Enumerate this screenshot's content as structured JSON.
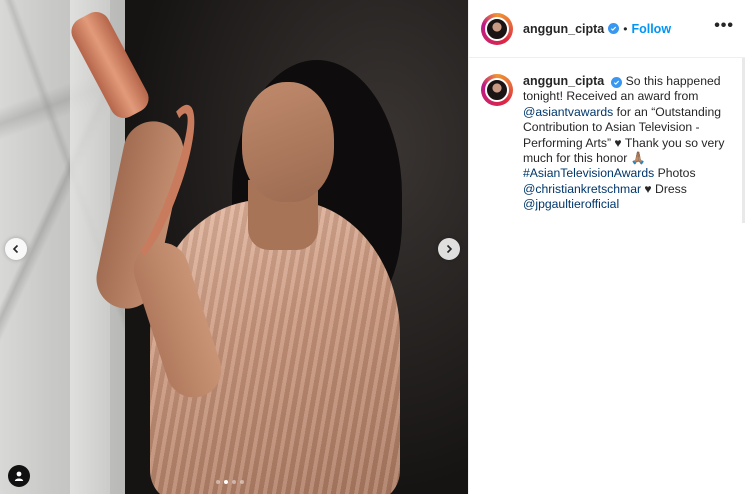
{
  "post": {
    "username": "anggun_cipta",
    "separator": "•",
    "follow_label": "Follow",
    "more_label": "•••"
  },
  "caption": {
    "username": "anggun_cipta",
    "part1": "So this happened tonight! Received an award from ",
    "mention1": "@asiantvawards",
    "part2": " for an “Outstanding Contribution to Asian Television - Performing Arts” ♥ Thank you so very much for this honor 🙏🏽 ",
    "hashtag1": "#AsianTelevisionAwards",
    "part3": " Photos ",
    "mention2": "@christiankretschmar",
    "part4": " ♥ Dress ",
    "mention3": "@jpgaultierofficial"
  },
  "carousel": {
    "dot_count": 4,
    "active_index": 1
  },
  "icons": {
    "prev": "chevron-left-icon",
    "next": "chevron-right-icon",
    "tags": "user-tag-icon",
    "verified": "verified-badge-icon"
  },
  "colors": {
    "link": "#00376b",
    "follow": "#0095f6",
    "verified": "#3897f0"
  }
}
